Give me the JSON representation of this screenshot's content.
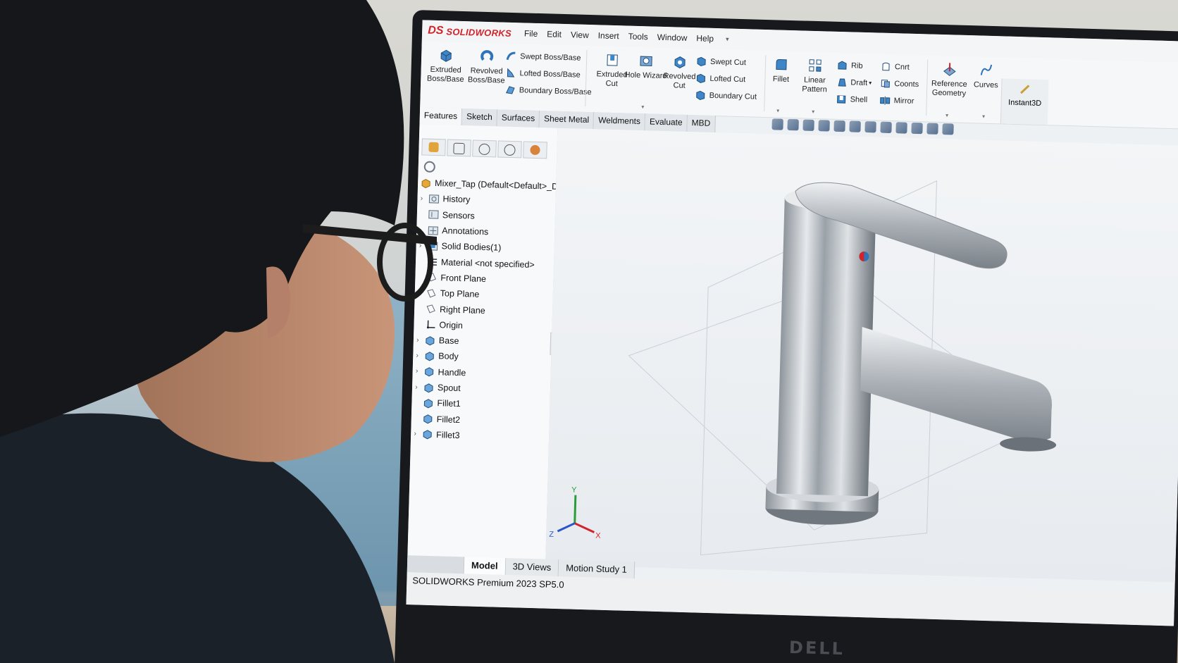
{
  "app": {
    "brand": "SOLIDWORKS",
    "menu": [
      "File",
      "Edit",
      "View",
      "Insert",
      "Tools",
      "Window",
      "Help"
    ]
  },
  "ribbon": {
    "extruded_boss": "Extruded Boss/Base",
    "revolved_boss": "Revolved Boss/Base",
    "swept_boss": "Swept Boss/Base",
    "lofted_boss": "Lofted Boss/Base",
    "boundary_boss": "Boundary Boss/Base",
    "extruded_cut": "Extruded Cut",
    "hole_wizard": "Hole Wizard",
    "revolved_cut": "Revolved Cut",
    "swept_cut": "Swept Cut",
    "lofted_cut": "Lofted Cut",
    "boundary_cut": "Boundary Cut",
    "fillet": "Fillet",
    "linear_pattern": "Linear Pattern",
    "rib": "Rib",
    "draft": "Draft",
    "shell": "Shell",
    "wrap": "Cnrt",
    "intersect": "Coonts",
    "mirror": "Mirror",
    "reference_geometry": "Reference Geometry",
    "curves": "Curves",
    "instant3d": "Instant3D"
  },
  "command_tabs": [
    "Features",
    "Sketch",
    "Surfaces",
    "Sheet Metal",
    "Weldments",
    "Evaluate",
    "MBD"
  ],
  "tree": {
    "root": "Mixer_Tap  (Default<Default>_Dis",
    "items": [
      {
        "label": "History",
        "expandable": true
      },
      {
        "label": "Sensors",
        "expandable": false
      },
      {
        "label": "Annotations",
        "expandable": true
      },
      {
        "label": "Solid Bodies(1)",
        "expandable": true
      },
      {
        "label": "Material <not specified>",
        "expandable": false
      },
      {
        "label": "Front Plane",
        "expandable": false
      },
      {
        "label": "Top Plane",
        "expandable": false
      },
      {
        "label": "Right Plane",
        "expandable": false
      },
      {
        "label": "Origin",
        "expandable": false
      },
      {
        "label": "Base",
        "expandable": true
      },
      {
        "label": "Body",
        "expandable": true
      },
      {
        "label": "Handle",
        "expandable": true
      },
      {
        "label": "Spout",
        "expandable": true
      },
      {
        "label": "Fillet1",
        "expandable": false
      },
      {
        "label": "Fillet2",
        "expandable": false
      },
      {
        "label": "Fillet3",
        "expandable": true
      }
    ]
  },
  "triad": {
    "x": "X",
    "y": "Y",
    "z": "Z"
  },
  "bottom_tabs": [
    "Model",
    "3D Views",
    "Motion Study 1"
  ],
  "status": "SOLIDWORKS Premium 2023 SP5.0",
  "monitor_brand": "DELL",
  "colors": {
    "brand_red": "#d2232a",
    "icon_blue": "#2f73b8",
    "chrome": "#c9ced3"
  }
}
